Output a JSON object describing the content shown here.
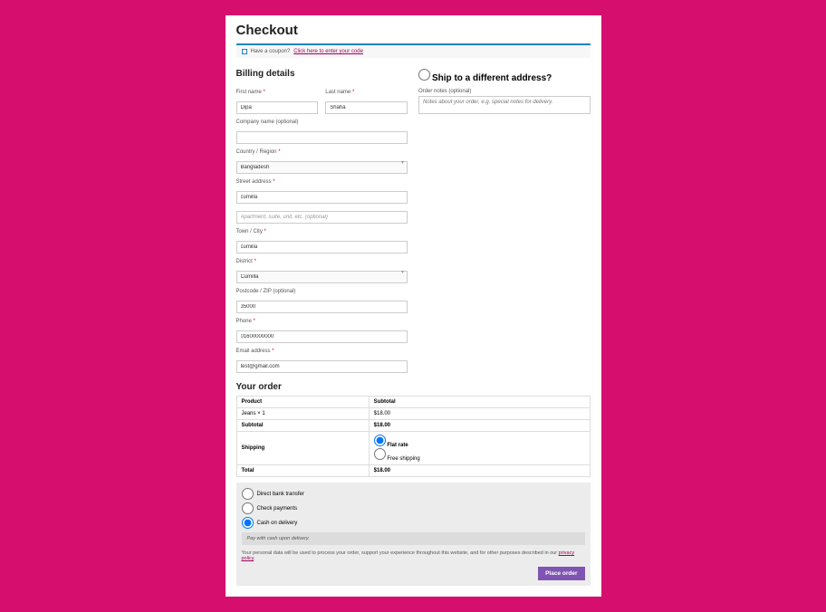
{
  "page_title": "Checkout",
  "coupon": {
    "text": "Have a coupon?",
    "link": "Click here to enter your code"
  },
  "billing": {
    "heading": "Billing details",
    "first_name_label": "First name",
    "first_name": "Dipa",
    "last_name_label": "Last name",
    "last_name": "Shaha",
    "company_label": "Company name (optional)",
    "company": "",
    "country_label": "Country / Region",
    "country": "Bangladesh",
    "street_label": "Street address",
    "street1": "cumilla",
    "street2_placeholder": "Apartment, suite, unit, etc. (optional)",
    "city_label": "Town / City",
    "city": "cumilla",
    "district_label": "District",
    "district": "Cumilla",
    "postcode_label": "Postcode / ZIP (optional)",
    "postcode": "35000",
    "phone_label": "Phone",
    "phone": "01600000000",
    "email_label": "Email address",
    "email": "test@gmail.com"
  },
  "shipping": {
    "heading": "Ship to a different address?",
    "notes_label": "Order notes (optional)",
    "notes_placeholder": "Notes about your order, e.g. special notes for delivery."
  },
  "order": {
    "heading": "Your order",
    "col_product": "Product",
    "col_subtotal": "Subtotal",
    "item_name": "Jeans  × 1",
    "item_price": "$18.00",
    "subtotal_label": "Subtotal",
    "subtotal": "$18.00",
    "shipping_label": "Shipping",
    "ship_flat": "Flat rate",
    "ship_free": "Free shipping",
    "total_label": "Total",
    "total": "$18.00"
  },
  "payment": {
    "opt1": "Direct bank transfer",
    "opt2": "Check payments",
    "opt3": "Cash on delivery",
    "desc": "Pay with cash upon delivery.",
    "privacy": "Your personal data will be used to process your order, support your experience throughout this website, and for other purposes described in our ",
    "privacy_link": "privacy policy",
    "button": "Place order"
  }
}
